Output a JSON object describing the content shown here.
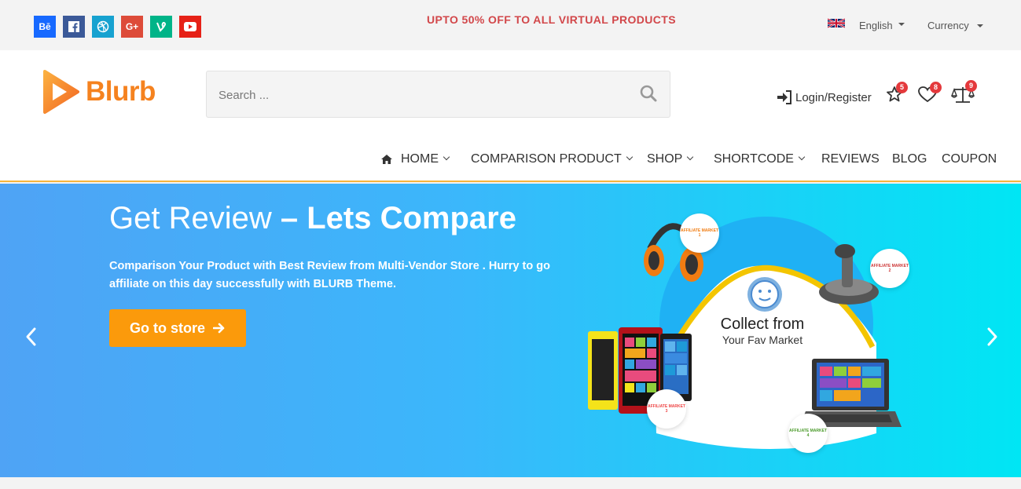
{
  "topbar": {
    "social": [
      {
        "name": "behance",
        "label": "Bē",
        "color": "#1769ff"
      },
      {
        "name": "facebook",
        "label": "f",
        "color": "#3b5998"
      },
      {
        "name": "dribbble",
        "label": "◎",
        "color": "#17a2d0"
      },
      {
        "name": "google-plus",
        "label": "G+",
        "color": "#dd4b39"
      },
      {
        "name": "vine",
        "label": "V",
        "color": "#00b488"
      },
      {
        "name": "youtube",
        "label": "▶",
        "color": "#e62117"
      }
    ],
    "promo": "UPTO 50% OFF TO ALL VIRTUAL PRODUCTS",
    "language": "English",
    "currency": "Currency"
  },
  "header": {
    "logo_text": "Blurb",
    "search_placeholder": "Search ...",
    "login_label": "Login/Register",
    "compare_count": "5",
    "wishlist_count": "8",
    "scale_count": "9"
  },
  "nav": {
    "home": "HOME",
    "comparison": "COMPARISON PRODUCT",
    "shop": "SHOP",
    "shortcode": "SHORTCODE",
    "reviews": "REVIEWS",
    "blog": "BLOG",
    "coupon": "COUPON"
  },
  "hero": {
    "title_light": "Get Review ",
    "title_bold": "– Lets Compare",
    "text": "Comparison Your Product with Best Review from Multi-Vendor Store . Hurry to go affiliate on this day successfully with BLURB Theme.",
    "button_label": "Go to store",
    "collect_big": "Collect from",
    "collect_small": "Your Fav Market",
    "market_1": "AFFILIATE MARKET 1",
    "market_2": "AFFILIATE MARKET 2",
    "market_3": "AFFILIATE MARKET 3",
    "market_4": "AFFILIATE MARKET 4"
  },
  "colors": {
    "accent_orange": "#f5821f",
    "promo_red": "#d2474a",
    "button_orange": "#fb9a0b",
    "badge_red": "#e4393c"
  }
}
